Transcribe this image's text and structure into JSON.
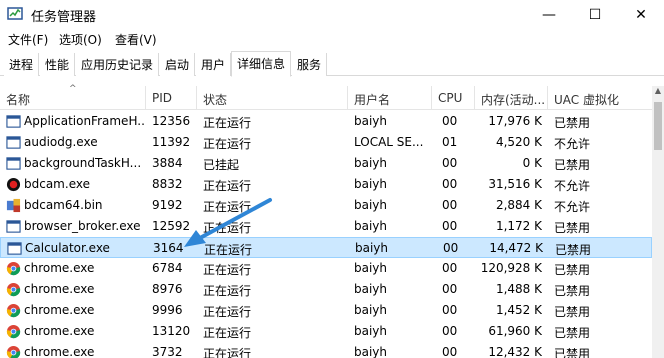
{
  "window": {
    "title": "任务管理器",
    "min": "—",
    "max": "☐",
    "close": "✕"
  },
  "menu": [
    {
      "label": "文件(F)"
    },
    {
      "label": "选项(O)"
    },
    {
      "label": "查看(V)"
    }
  ],
  "tabs": [
    {
      "label": "进程"
    },
    {
      "label": "性能"
    },
    {
      "label": "应用历史记录"
    },
    {
      "label": "启动"
    },
    {
      "label": "用户"
    },
    {
      "label": "详细信息",
      "active": true
    },
    {
      "label": "服务"
    }
  ],
  "columns": [
    "名称",
    "PID",
    "状态",
    "用户名",
    "CPU",
    "内存(活动...",
    "UAC 虚拟化"
  ],
  "sort_indicator": "^",
  "rows": [
    {
      "icon": "app-frame-icon",
      "name": "ApplicationFrameH...",
      "pid": "12356",
      "status": "正在运行",
      "user": "baiyh",
      "cpu": "00",
      "mem": "17,976 K",
      "uac": "已禁用"
    },
    {
      "icon": "app-frame-icon",
      "name": "audiodg.exe",
      "pid": "11392",
      "status": "正在运行",
      "user": "LOCAL SE...",
      "cpu": "01",
      "mem": "4,520 K",
      "uac": "不允许"
    },
    {
      "icon": "app-frame-icon",
      "name": "backgroundTaskH...",
      "pid": "3884",
      "status": "已挂起",
      "user": "baiyh",
      "cpu": "00",
      "mem": "0 K",
      "uac": "已禁用"
    },
    {
      "icon": "bdcam-record-icon",
      "name": "bdcam.exe",
      "pid": "8832",
      "status": "正在运行",
      "user": "baiyh",
      "cpu": "00",
      "mem": "31,516 K",
      "uac": "不允许"
    },
    {
      "icon": "bdcam64-icon",
      "name": "bdcam64.bin",
      "pid": "9192",
      "status": "正在运行",
      "user": "baiyh",
      "cpu": "00",
      "mem": "2,884 K",
      "uac": "不允许"
    },
    {
      "icon": "app-frame-icon",
      "name": "browser_broker.exe",
      "pid": "12592",
      "status": "正在运行",
      "user": "baiyh",
      "cpu": "00",
      "mem": "1,172 K",
      "uac": "已禁用"
    },
    {
      "icon": "app-frame-icon",
      "name": "Calculator.exe",
      "pid": "3164",
      "status": "正在运行",
      "user": "baiyh",
      "cpu": "00",
      "mem": "14,472 K",
      "uac": "已禁用",
      "selected": true
    },
    {
      "icon": "chrome-icon",
      "name": "chrome.exe",
      "pid": "6784",
      "status": "正在运行",
      "user": "baiyh",
      "cpu": "00",
      "mem": "120,928 K",
      "uac": "已禁用"
    },
    {
      "icon": "chrome-icon",
      "name": "chrome.exe",
      "pid": "8976",
      "status": "正在运行",
      "user": "baiyh",
      "cpu": "00",
      "mem": "1,488 K",
      "uac": "已禁用"
    },
    {
      "icon": "chrome-icon",
      "name": "chrome.exe",
      "pid": "9996",
      "status": "正在运行",
      "user": "baiyh",
      "cpu": "00",
      "mem": "1,452 K",
      "uac": "已禁用"
    },
    {
      "icon": "chrome-icon",
      "name": "chrome.exe",
      "pid": "13120",
      "status": "正在运行",
      "user": "baiyh",
      "cpu": "00",
      "mem": "61,960 K",
      "uac": "已禁用"
    },
    {
      "icon": "chrome-icon",
      "name": "chrome.exe",
      "pid": "3732",
      "status": "正在运行",
      "user": "baiyh",
      "cpu": "00",
      "mem": "12,432 K",
      "uac": "已禁用"
    }
  ],
  "annotation": {
    "arrow_color": "#2f86d6"
  },
  "colors": {
    "selected_bg": "#cce8ff",
    "selected_border": "#99d1ff"
  }
}
